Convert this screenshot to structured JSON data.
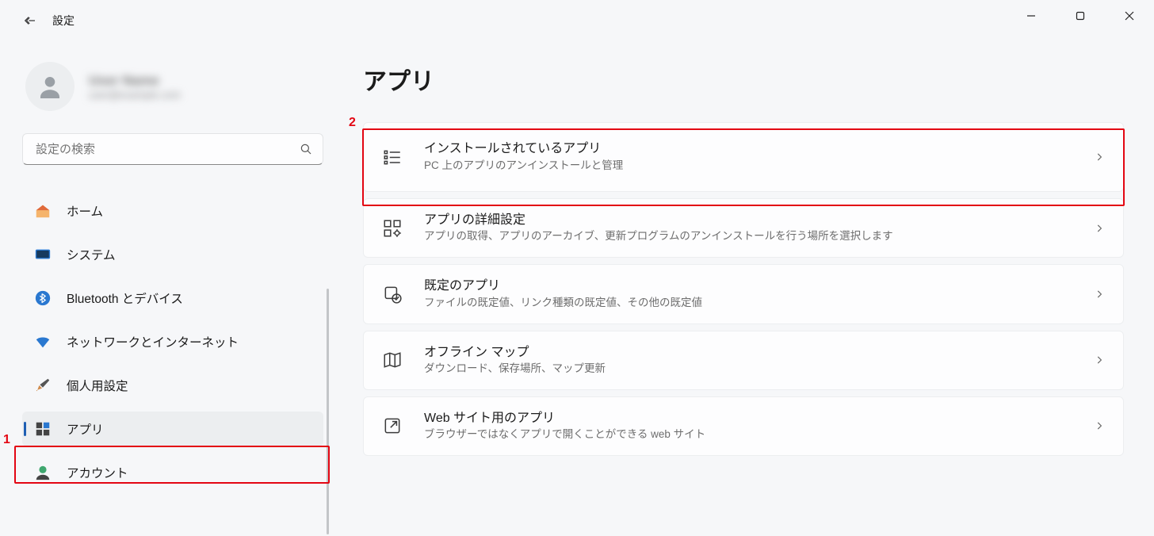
{
  "window": {
    "title": "設定"
  },
  "search": {
    "placeholder": "設定の検索"
  },
  "profile": {
    "name": "User Name",
    "sub": "user@example.com"
  },
  "sidebar": {
    "items": [
      {
        "label": "ホーム",
        "active": false
      },
      {
        "label": "システム",
        "active": false
      },
      {
        "label": "Bluetooth とデバイス",
        "active": false
      },
      {
        "label": "ネットワークとインターネット",
        "active": false
      },
      {
        "label": "個人用設定",
        "active": false
      },
      {
        "label": "アプリ",
        "active": true
      },
      {
        "label": "アカウント",
        "active": false
      }
    ]
  },
  "page": {
    "title": "アプリ"
  },
  "annotations": {
    "marker1": "1",
    "marker2": "2"
  },
  "cards": [
    {
      "title": "インストールされているアプリ",
      "sub": "PC 上のアプリのアンインストールと管理"
    },
    {
      "title": "アプリの詳細設定",
      "sub": "アプリの取得、アプリのアーカイブ、更新プログラムのアンインストールを行う場所を選択します"
    },
    {
      "title": "既定のアプリ",
      "sub": "ファイルの既定値、リンク種類の既定値、その他の既定値"
    },
    {
      "title": "オフライン マップ",
      "sub": "ダウンロード、保存場所、マップ更新"
    },
    {
      "title": "Web サイト用のアプリ",
      "sub": "ブラウザーではなくアプリで開くことができる web サイト"
    }
  ]
}
